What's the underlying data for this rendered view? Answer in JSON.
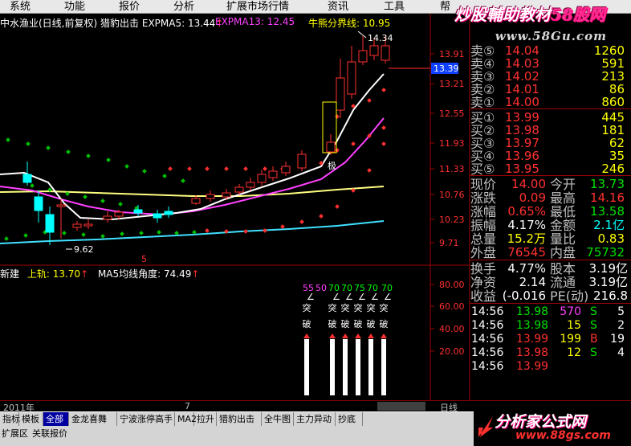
{
  "menu": [
    "系统",
    "功能",
    "报价",
    "分析",
    "扩展市场行情",
    "资讯",
    "工具",
    "帮"
  ],
  "watermark": {
    "top_text": "炒股輔助教材",
    "top_accent": "58股网",
    "top_url": "www.58Gu.com",
    "bottom_text": "分析家公式网",
    "bottom_url": "www.88gs.com"
  },
  "main_header": {
    "stock": "中水渔业(日线,前复权)",
    "indicator": "猎豹出击",
    "expma5": "EXPMA5: 13.44",
    "expma13": "EXPMA13: 12.45",
    "bullbear": "牛熊分界线: 10.95"
  },
  "sub_header": {
    "name": "新建",
    "upper": "上轨: 13.70",
    "ma5angle": "MA5均线角度: 74.49"
  },
  "annotations": {
    "high": "14.34",
    "low": "9.62",
    "tag": "极",
    "marker": "5",
    "cur_price_tag": "13.39",
    "time_left": "2011年",
    "time_mid": "7",
    "period": "日线"
  },
  "price_axis": [
    "13.91",
    "13.21",
    "12.55",
    "11.93",
    "11.33",
    "10.76",
    "10.23",
    "9.71"
  ],
  "sub_axis": [
    "80.00",
    "60.00",
    "40.00",
    "20.00"
  ],
  "signals": {
    "values": [
      "55",
      "50",
      "70",
      "70",
      "75",
      "70",
      "70"
    ],
    "char1": "突",
    "char2": "破"
  },
  "quote": {
    "sells": [
      {
        "label": "卖⑤",
        "price": "14.04",
        "vol": "1260"
      },
      {
        "label": "卖④",
        "price": "14.03",
        "vol": "591"
      },
      {
        "label": "卖③",
        "price": "14.02",
        "vol": "213"
      },
      {
        "label": "卖②",
        "price": "14.01",
        "vol": "86"
      },
      {
        "label": "卖①",
        "price": "14.00",
        "vol": "860"
      }
    ],
    "buys": [
      {
        "label": "买①",
        "price": "13.99",
        "vol": "445"
      },
      {
        "label": "买②",
        "price": "13.98",
        "vol": "181"
      },
      {
        "label": "买③",
        "price": "13.97",
        "vol": "62"
      },
      {
        "label": "买④",
        "price": "13.96",
        "vol": "35"
      },
      {
        "label": "买⑤",
        "price": "13.95",
        "vol": "246"
      }
    ],
    "stats": [
      {
        "l1": "现价",
        "v1": "14.00",
        "l2": "今开",
        "v2": "13.73",
        "c1": "red",
        "c2": "green"
      },
      {
        "l1": "涨跌",
        "v1": "0.09",
        "l2": "最高",
        "v2": "14.16",
        "c1": "red",
        "c2": "red"
      },
      {
        "l1": "涨幅",
        "v1": "0.65%",
        "l2": "最低",
        "v2": "13.58",
        "c1": "red",
        "c2": "green"
      },
      {
        "l1": "振幅",
        "v1": "4.17%",
        "l2": "金额",
        "v2": "2.1亿",
        "c1": "white",
        "c2": "cyan"
      },
      {
        "l1": "总量",
        "v1": "15.2万",
        "l2": "量比",
        "v2": "0.83",
        "c1": "yellow",
        "c2": "yellow"
      },
      {
        "l1": "外盘",
        "v1": "76545",
        "l2": "内盘",
        "v2": "75732",
        "c1": "red",
        "c2": "green"
      }
    ],
    "info": [
      {
        "l1": "换手",
        "v1": "4.77%",
        "l2": "股本",
        "v2": "3.19亿"
      },
      {
        "l1": "净资",
        "v1": "2.14",
        "l2": "流通",
        "v2": "3.19亿"
      },
      {
        "l1": "收益",
        "v1": "(-0.016",
        "l2": "PE(动)",
        "v2": "216.8"
      }
    ],
    "ticks": [
      {
        "time": "14:56",
        "price": "13.98",
        "vol": "570",
        "bs": "S",
        "n": "5",
        "pc": "green",
        "vc": "magenta",
        "bc": "green"
      },
      {
        "time": "14:56",
        "price": "13.98",
        "vol": "15",
        "bs": "S",
        "n": "2",
        "pc": "green",
        "vc": "yellow",
        "bc": "green"
      },
      {
        "time": "14:56",
        "price": "13.99",
        "vol": "199",
        "bs": "B",
        "n": "19",
        "pc": "red",
        "vc": "yellow",
        "bc": "red"
      },
      {
        "time": "14:56",
        "price": "13.98",
        "vol": "12",
        "bs": "S",
        "n": "4",
        "pc": "red",
        "vc": "yellow",
        "bc": "green"
      },
      {
        "time": "14:56",
        "price": "13.99",
        "vol": "",
        "bs": "",
        "n": "",
        "pc": "red",
        "vc": "yellow",
        "bc": "green"
      }
    ]
  },
  "tabs": [
    {
      "label": "指标",
      "active": false
    },
    {
      "label": "模板",
      "active": false
    },
    {
      "label": "全部",
      "active": true
    },
    {
      "label": "金龙喜舞",
      "active": false
    },
    {
      "label": "宁波涨停高手",
      "active": false
    },
    {
      "label": "MA2",
      "active": false
    },
    {
      "label": "拉升",
      "active": false
    },
    {
      "label": "猎豹出击",
      "active": false
    },
    {
      "label": "全牛图",
      "active": false
    },
    {
      "label": "主力异动",
      "active": false
    },
    {
      "label": "抄底",
      "active": false
    }
  ],
  "status_tabs": [
    "扩展区",
    "关联报价"
  ],
  "colors": {
    "up": "#ff3030",
    "down": "#00ffff",
    "expma5": "#ffffff",
    "expma13": "#ff40ff",
    "bull_line": "#ffff80",
    "cyan_line": "#40e0ff"
  }
}
